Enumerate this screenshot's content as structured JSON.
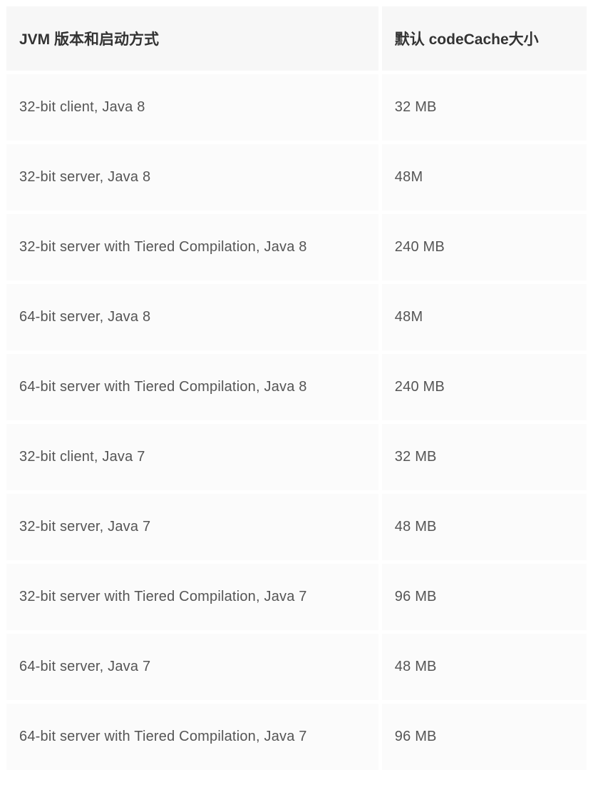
{
  "table": {
    "headers": {
      "col1": "JVM 版本和启动方式",
      "col2": "默认 codeCache大小"
    },
    "rows": [
      {
        "jvm": "32-bit client, Java 8",
        "size": "32 MB"
      },
      {
        "jvm": "32-bit server, Java 8",
        "size": "48M"
      },
      {
        "jvm": "32-bit server with Tiered Compilation, Java 8",
        "size": "240 MB"
      },
      {
        "jvm": "64-bit server, Java 8",
        "size": "48M"
      },
      {
        "jvm": "64-bit server with Tiered Compilation, Java 8",
        "size": "240 MB"
      },
      {
        "jvm": "32-bit client, Java 7",
        "size": "32 MB"
      },
      {
        "jvm": "32-bit server, Java 7",
        "size": "48 MB"
      },
      {
        "jvm": "32-bit server with Tiered Compilation, Java 7",
        "size": "96 MB"
      },
      {
        "jvm": "64-bit server, Java 7",
        "size": "48 MB"
      },
      {
        "jvm": "64-bit server with Tiered Compilation, Java 7",
        "size": "96 MB"
      }
    ]
  }
}
